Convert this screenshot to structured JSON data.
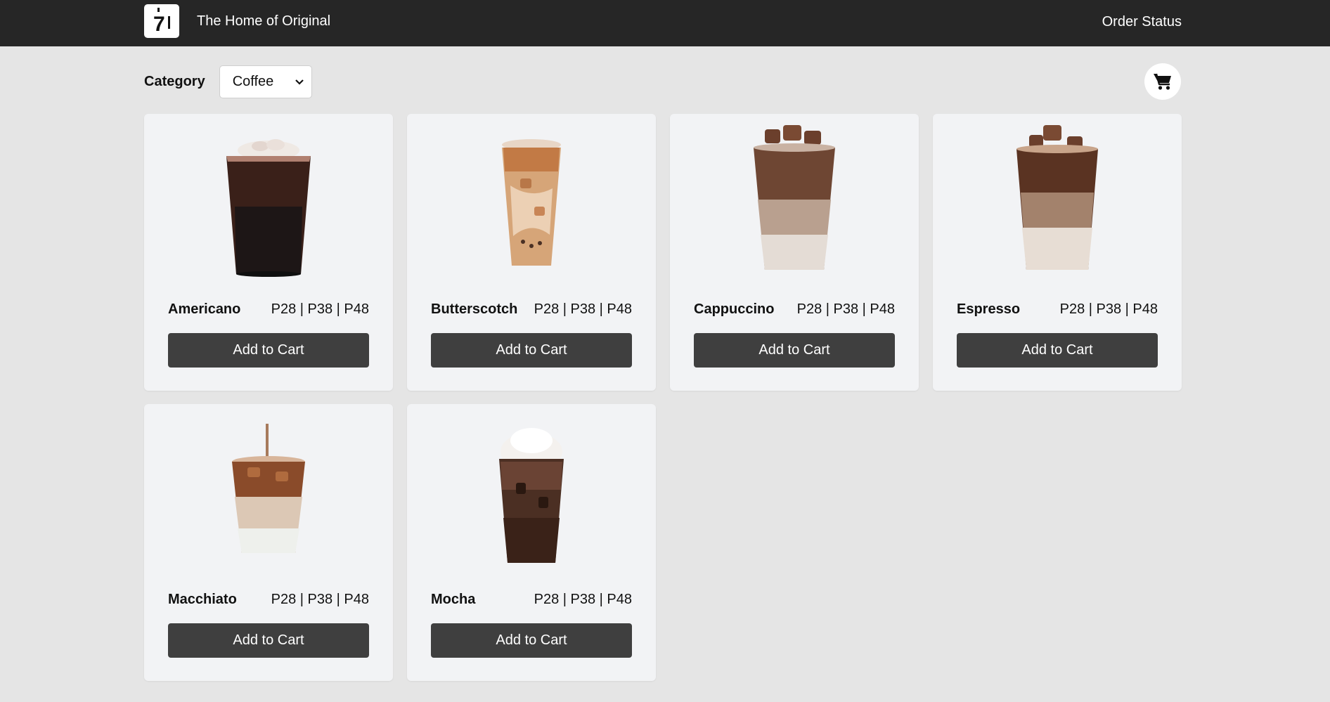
{
  "header": {
    "title": "The Home of Original",
    "logo_text": "7",
    "order_status": "Order Status"
  },
  "filter": {
    "label": "Category",
    "selected": "Coffee"
  },
  "cart": {
    "icon": "cart-icon"
  },
  "products": [
    {
      "name": "Americano",
      "prices": "P28 | P38 | P48",
      "button": "Add to Cart"
    },
    {
      "name": "Butterscotch",
      "prices": "P28 | P38 | P48",
      "button": "Add to Cart"
    },
    {
      "name": "Cappuccino",
      "prices": "P28 | P38 | P48",
      "button": "Add to Cart"
    },
    {
      "name": "Espresso",
      "prices": "P28 | P38 | P48",
      "button": "Add to Cart"
    },
    {
      "name": "Macchiato",
      "prices": "P28 | P38 | P48",
      "button": "Add to Cart"
    },
    {
      "name": "Mocha",
      "prices": "P28 | P38 | P48",
      "button": "Add to Cart"
    }
  ],
  "colors": {
    "topbar": "#262626",
    "background": "#e5e5e5",
    "card": "#f2f3f5",
    "button": "#3f3f3f"
  }
}
